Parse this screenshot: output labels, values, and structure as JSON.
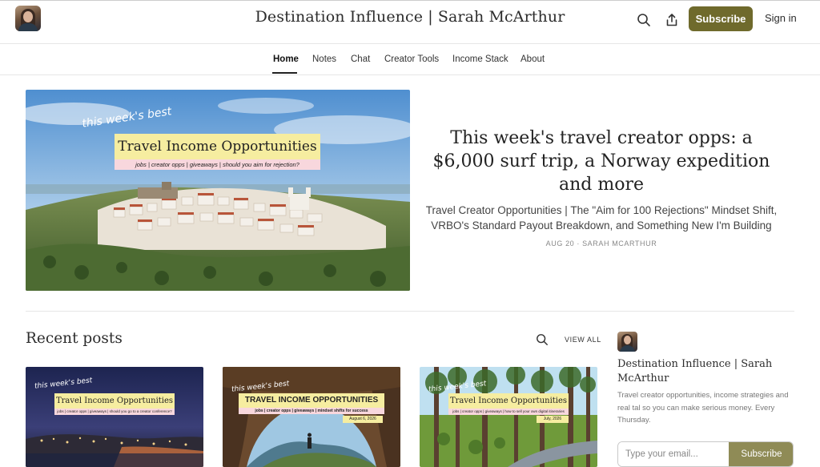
{
  "header": {
    "site_title": "Destination Influence | Sarah McArthur",
    "subscribe_label": "Subscribe",
    "signin_label": "Sign in",
    "icons": [
      "search-icon",
      "share-icon"
    ]
  },
  "nav": {
    "items": [
      "Home",
      "Notes",
      "Chat",
      "Creator Tools",
      "Income Stack",
      "About"
    ],
    "active": "Home"
  },
  "hero": {
    "image": {
      "script_caption": "this week's best",
      "banner_title": "Travel Income Opportunities",
      "banner_subtitle": "jobs | creator opps | giveaways | should you aim for rejection?"
    },
    "title": "This week's travel creator opps: a $6,000 surf trip, a Norway expedition and more",
    "subtitle": "Travel Creator Opportunities | The \"Aim for 100 Rejections\" Mindset Shift, VRBO's Standard Payout Breakdown, and Something New I'm Building",
    "meta": "AUG 20 · SARAH MCARTHUR"
  },
  "recent": {
    "heading": "Recent posts",
    "view_all": "VIEW ALL",
    "cards": [
      {
        "script_caption": "this week's best",
        "banner_title": "Travel Income Opportunities",
        "banner_subtitle": "jobs | creator opps | giveaways | should you go to a creator conference?"
      },
      {
        "script_caption": "this week's best",
        "banner_title": "TRAVEL INCOME OPPORTUNITIES",
        "banner_subtitle": "jobs | creator opps | giveaways | mindset shifts for success",
        "date": "August 6, 2026"
      },
      {
        "script_caption": "this week's best",
        "banner_title": "Travel Income Opportunities",
        "banner_subtitle": "jobs | creator opps | giveaways | how to sell your own digital itineraries",
        "date": "July, 2026"
      }
    ]
  },
  "sidebar": {
    "name": "Destination Influence | Sarah McArthur",
    "description": "Travel creator opportunities, income strategies and real tal so you can make serious money. Every Thursday.",
    "email_placeholder": "Type your email...",
    "subscribe_label": "Subscribe"
  },
  "colors": {
    "accent": "#6f6a2c",
    "accent_light": "#8f8b56",
    "banner_yellow": "#f6eda0"
  }
}
